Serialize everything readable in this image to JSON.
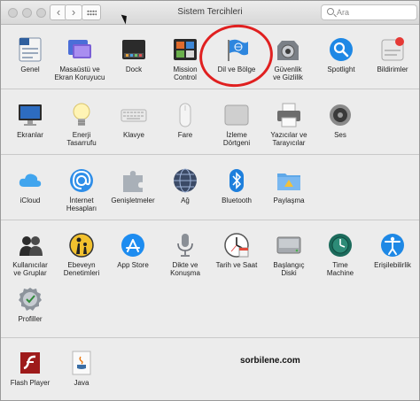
{
  "window": {
    "title": "Sistem Tercihleri"
  },
  "search": {
    "placeholder": "Ara"
  },
  "nav": {
    "back": "‹",
    "forward": "›"
  },
  "sections": {
    "personal": [
      {
        "id": "genel",
        "label": "Genel",
        "icon": "general-icon"
      },
      {
        "id": "masaustu",
        "label": "Masaüstü ve\nEkran Koruyucu",
        "icon": "desktop-screensaver-icon"
      },
      {
        "id": "dock",
        "label": "Dock",
        "icon": "dock-icon"
      },
      {
        "id": "mission",
        "label": "Mission\nControl",
        "icon": "mission-control-icon"
      },
      {
        "id": "dilbolge",
        "label": "Dil ve Bölge",
        "icon": "language-region-icon"
      },
      {
        "id": "guvenlik",
        "label": "Güvenlik\nve Gizlilik",
        "icon": "security-privacy-icon"
      },
      {
        "id": "spotlight",
        "label": "Spotlight",
        "icon": "spotlight-icon"
      },
      {
        "id": "bildirim",
        "label": "Bildirimler",
        "icon": "notifications-icon"
      }
    ],
    "hardware": [
      {
        "id": "ekranlar",
        "label": "Ekranlar",
        "icon": "displays-icon"
      },
      {
        "id": "enerji",
        "label": "Enerji\nTasarrufu",
        "icon": "energy-saver-icon"
      },
      {
        "id": "klavye",
        "label": "Klavye",
        "icon": "keyboard-icon"
      },
      {
        "id": "fare",
        "label": "Fare",
        "icon": "mouse-icon"
      },
      {
        "id": "izleme",
        "label": "İzleme\nDörtgeni",
        "icon": "trackpad-icon"
      },
      {
        "id": "yazici",
        "label": "Yazıcılar ve\nTarayıcılar",
        "icon": "printer-icon"
      },
      {
        "id": "ses",
        "label": "Ses",
        "icon": "sound-icon"
      }
    ],
    "internet": [
      {
        "id": "icloud",
        "label": "iCloud",
        "icon": "icloud-icon"
      },
      {
        "id": "internet",
        "label": "İnternet\nHesapları",
        "icon": "internet-accounts-icon"
      },
      {
        "id": "genisletme",
        "label": "Genişletmeler",
        "icon": "extensions-icon"
      },
      {
        "id": "ag",
        "label": "Ağ",
        "icon": "network-icon"
      },
      {
        "id": "bluetooth",
        "label": "Bluetooth",
        "icon": "bluetooth-icon"
      },
      {
        "id": "paylasma",
        "label": "Paylaşma",
        "icon": "sharing-icon"
      }
    ],
    "system": [
      {
        "id": "kullanicilar",
        "label": "Kullanıcılar\nve Gruplar",
        "icon": "users-groups-icon"
      },
      {
        "id": "ebeveyn",
        "label": "Ebeveyn\nDenetimleri",
        "icon": "parental-controls-icon"
      },
      {
        "id": "appstore",
        "label": "App Store",
        "icon": "app-store-icon"
      },
      {
        "id": "dikte",
        "label": "Dikte ve\nKonuşma",
        "icon": "dictation-icon"
      },
      {
        "id": "tarih",
        "label": "Tarih ve Saat",
        "icon": "date-time-icon"
      },
      {
        "id": "baslangic",
        "label": "Başlangıç\nDiski",
        "icon": "startup-disk-icon"
      },
      {
        "id": "timemachine",
        "label": "Time\nMachine",
        "icon": "time-machine-icon"
      },
      {
        "id": "erisilebilirlik",
        "label": "Erişilebilirlik",
        "icon": "accessibility-icon"
      },
      {
        "id": "profiller",
        "label": "Profiller",
        "icon": "profiles-icon"
      }
    ],
    "other": [
      {
        "id": "flash",
        "label": "Flash Player",
        "icon": "flash-player-icon"
      },
      {
        "id": "java",
        "label": "Java",
        "icon": "java-icon"
      }
    ]
  },
  "watermark": "sorbilene.com",
  "colors": {
    "highlight_circle": "#e02020",
    "accent_blue": "#1e88e5"
  }
}
